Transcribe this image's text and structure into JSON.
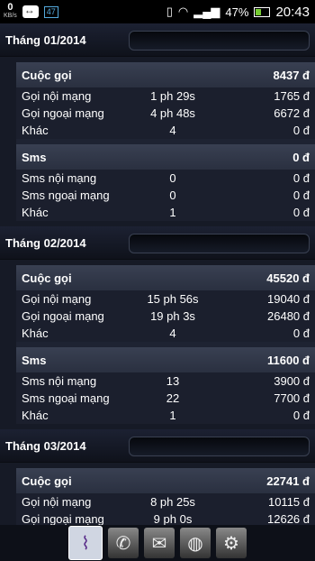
{
  "statusbar": {
    "kbs_value": "0",
    "kbs_unit": "KB/s",
    "msg_count": "47",
    "battery": "47%",
    "time": "20:43"
  },
  "months": [
    {
      "title": "Tháng 01/2014",
      "calls": {
        "label": "Cuộc gọi",
        "total": "8437 đ",
        "rows": [
          {
            "label": "Gọi nội mạng",
            "usage": "1 ph 29s",
            "cost": "1765 đ"
          },
          {
            "label": "Gọi ngoại mạng",
            "usage": "4 ph 48s",
            "cost": "6672 đ"
          },
          {
            "label": "Khác",
            "usage": "4",
            "cost": "0 đ"
          }
        ]
      },
      "sms": {
        "label": "Sms",
        "total": "0 đ",
        "rows": [
          {
            "label": "Sms nội mạng",
            "usage": "0",
            "cost": "0 đ"
          },
          {
            "label": "Sms ngoại mạng",
            "usage": "0",
            "cost": "0 đ"
          },
          {
            "label": "Khác",
            "usage": "1",
            "cost": "0 đ"
          }
        ]
      }
    },
    {
      "title": "Tháng 02/2014",
      "calls": {
        "label": "Cuộc gọi",
        "total": "45520 đ",
        "rows": [
          {
            "label": "Gọi nội mạng",
            "usage": "15 ph 56s",
            "cost": "19040 đ"
          },
          {
            "label": "Gọi ngoại mạng",
            "usage": "19 ph 3s",
            "cost": "26480 đ"
          },
          {
            "label": "Khác",
            "usage": "4",
            "cost": "0 đ"
          }
        ]
      },
      "sms": {
        "label": "Sms",
        "total": "11600 đ",
        "rows": [
          {
            "label": "Sms nội mạng",
            "usage": "13",
            "cost": "3900 đ"
          },
          {
            "label": "Sms ngoại mạng",
            "usage": "22",
            "cost": "7700 đ"
          },
          {
            "label": "Khác",
            "usage": "1",
            "cost": "0 đ"
          }
        ]
      }
    },
    {
      "title": "Tháng 03/2014",
      "calls": {
        "label": "Cuộc gọi",
        "total": "22741 đ",
        "rows": [
          {
            "label": "Gọi nội mạng",
            "usage": "8 ph 25s",
            "cost": "10115 đ"
          },
          {
            "label": "Gọi ngoại mạng",
            "usage": "9 ph 0s",
            "cost": "12626 đ"
          }
        ]
      }
    }
  ],
  "bottom_tabs": [
    {
      "icon": "activity-chart-icon",
      "glyph": "⌇"
    },
    {
      "icon": "phone-icon",
      "glyph": "✆"
    },
    {
      "icon": "envelope-icon",
      "glyph": "✉"
    },
    {
      "icon": "globe-icon",
      "glyph": "◍"
    },
    {
      "icon": "gear-icon",
      "glyph": "⚙"
    }
  ]
}
